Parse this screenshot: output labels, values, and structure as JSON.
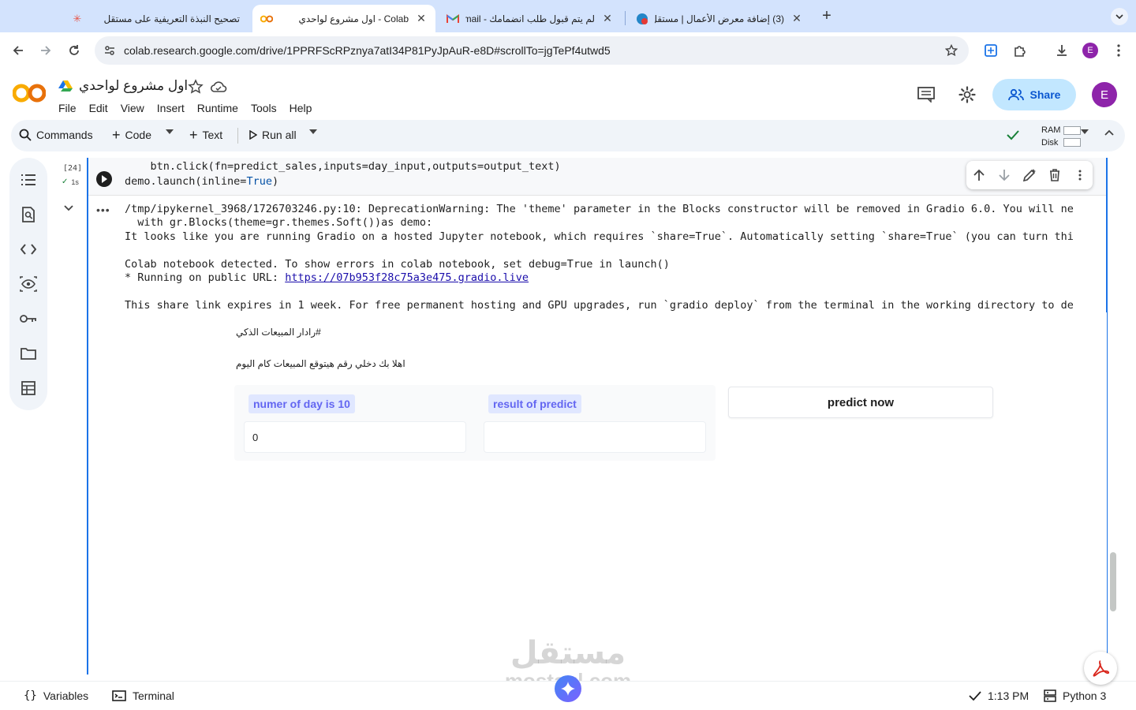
{
  "browser": {
    "tabs": [
      {
        "title": "تصحيح النبذة التعريفية على مستقل",
        "icon": "mostaql-favicon-icon"
      },
      {
        "title": "Colab - اول مشروع لواحدي",
        "icon": "colab-favicon-icon"
      },
      {
        "title": "لم يتم قبول طلب انضمامك - mail",
        "icon": "gmail-favicon-icon"
      },
      {
        "title": "(3) إضافة معرض الأعمال | مستقل",
        "icon": "mostaql-badge-favicon-icon"
      }
    ],
    "url": "colab.research.google.com/drive/1PPRFScRPznya7atI34P81PyJpAuR-e8D#scrollTo=jgTePf4utwd5",
    "profile_initial": "E"
  },
  "colab": {
    "notebook_title": "اول مشروع لواحدي",
    "menu": [
      "File",
      "Edit",
      "View",
      "Insert",
      "Runtime",
      "Tools",
      "Help"
    ],
    "share_label": "Share",
    "avatar_initial": "E",
    "toolbar": {
      "commands": "Commands",
      "code": "Code",
      "text": "Text",
      "run_all": "Run all",
      "ram": "RAM",
      "disk": "Disk"
    }
  },
  "cell": {
    "exec_count": "[24]",
    "exec_time": "1s",
    "code_lines": [
      "    btn.click(fn=predict_sales,inputs=day_input,outputs=output_text)",
      "demo.launch(inline=True)"
    ],
    "code_keyword": "True",
    "output_lines": [
      "/tmp/ipykernel_3968/1726703246.py:10: DeprecationWarning: The 'theme' parameter in the Blocks constructor will be removed in Gradio 6.0. You will ne",
      "  with gr.Blocks(theme=gr.themes.Soft())as demo:",
      "It looks like you are running Gradio on a hosted Jupyter notebook, which requires `share=True`. Automatically setting `share=True` (you can turn thi",
      "",
      "Colab notebook detected. To show errors in colab notebook, set debug=True in launch()",
      "* Running on public URL: ",
      "",
      "This share link expires in 1 week. For free permanent hosting and GPU upgrades, run `gradio deploy` from the terminal in the working directory to de"
    ],
    "public_url": "https://07b953f28c75a3e475.gradio.live"
  },
  "gradio": {
    "heading": "#رادار المبيعات الذكي",
    "subtitle": "اهلا بك دخلي رقم هيتوقع المبيعات كام اليوم",
    "input_label": "numer of day is 10",
    "input_value": "0",
    "output_label": "result of predict",
    "output_value": "",
    "button_label": "predict now"
  },
  "statusbar": {
    "variables": "Variables",
    "terminal": "Terminal",
    "time": "1:13 PM",
    "runtime": "Python 3"
  },
  "watermark": {
    "arabic": "مستقل",
    "latin": "mostaql.com"
  },
  "colors": {
    "accent": "#1a73e8",
    "gradio_label_text": "#6366f1",
    "gradio_label_bg": "#e0e7ff",
    "share_bg": "#c2e7ff",
    "avatar": "#8e24aa"
  }
}
